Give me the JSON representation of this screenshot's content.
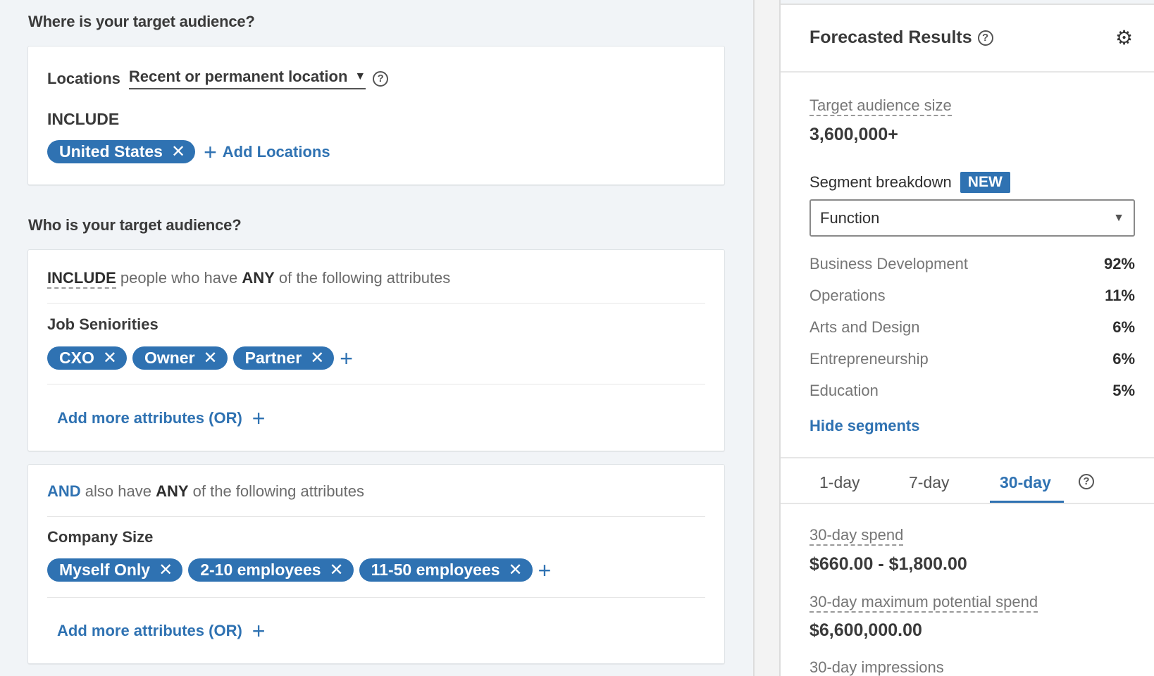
{
  "where": {
    "heading": "Where is your target audience?",
    "locations_label": "Locations",
    "location_type": "Recent or permanent location",
    "include_label": "INCLUDE",
    "chips": [
      "United States"
    ],
    "add_locations": "Add Locations"
  },
  "who": {
    "heading": "Who is your target audience?",
    "group1": {
      "prefix": "INCLUDE",
      "middle": " people who have ",
      "any": "ANY",
      "suffix": " of the following attributes",
      "facet_label": "Job Seniorities",
      "chips": [
        "CXO",
        "Owner",
        "Partner"
      ],
      "add_more": "Add more attributes (OR)"
    },
    "group2": {
      "prefix": "AND",
      "middle": " also have ",
      "any": "ANY",
      "suffix": " of the following attributes",
      "facet_label": "Company Size",
      "chips": [
        "Myself Only",
        "2-10 employees",
        "11-50 employees"
      ],
      "add_more": "Add more attributes (OR)"
    }
  },
  "forecast": {
    "title": "Forecasted Results",
    "audience_label": "Target audience size",
    "audience_value": "3,600,000+",
    "segment_label": "Segment breakdown",
    "new_badge": "NEW",
    "segment_select": "Function",
    "segments": [
      {
        "name": "Business Development",
        "pct": "92%"
      },
      {
        "name": "Operations",
        "pct": "11%"
      },
      {
        "name": "Arts and Design",
        "pct": "6%"
      },
      {
        "name": "Entrepreneurship",
        "pct": "6%"
      },
      {
        "name": "Education",
        "pct": "5%"
      }
    ],
    "hide_segments": "Hide segments",
    "tabs": [
      "1-day",
      "7-day",
      "30-day"
    ],
    "active_tab": "30-day",
    "spend_label": "30-day spend",
    "spend_value": "$660.00 - $1,800.00",
    "max_spend_label": "30-day maximum potential spend",
    "max_spend_value": "$6,600,000.00",
    "impressions_label": "30-day impressions"
  },
  "colors": {
    "accent": "#2f72b2",
    "background": "#f1f4f7"
  }
}
